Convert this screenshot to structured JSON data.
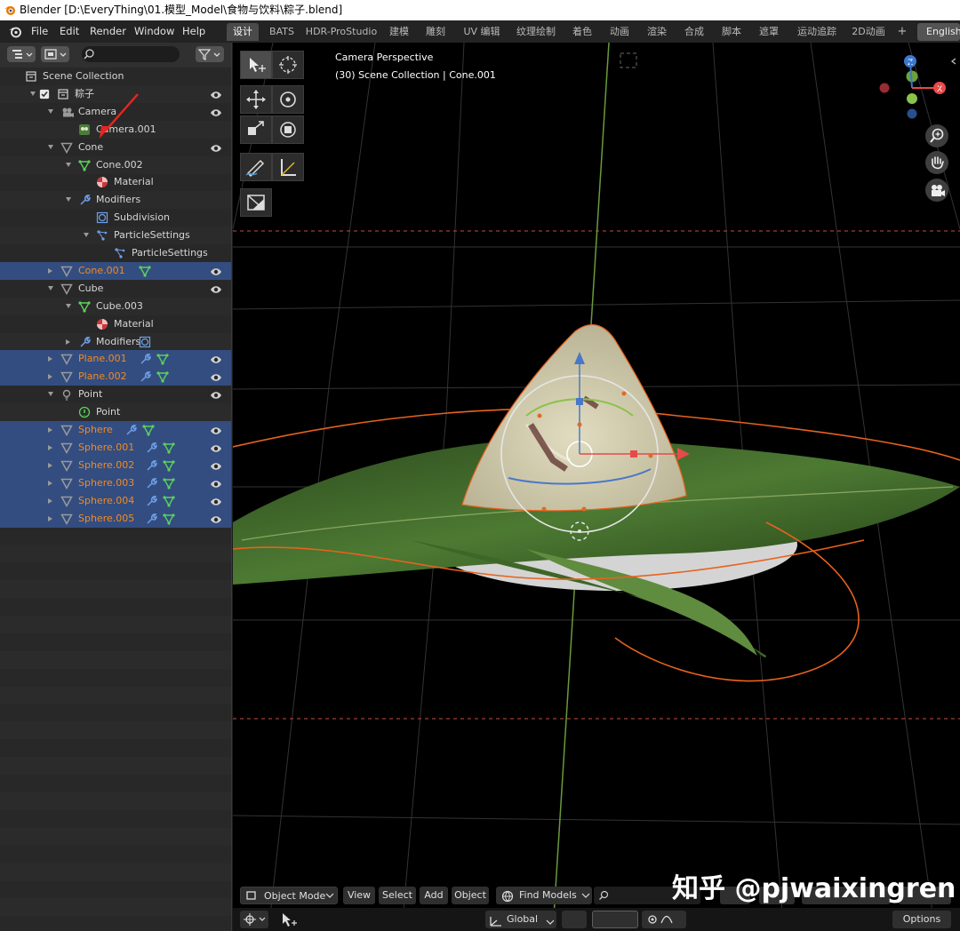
{
  "titlebar": {
    "title": "Blender [D:\\EveryThing\\01.模型_Model\\食物与饮料\\粽子.blend]"
  },
  "menu": [
    "File",
    "Edit",
    "Render",
    "Window",
    "Help"
  ],
  "workspace_tabs": [
    "设计",
    "BATS",
    "HDR-ProStudio",
    "建模",
    "雕刻",
    "UV 编辑",
    "纹理绘制",
    "着色",
    "动画",
    "渲染",
    "合成",
    "脚本",
    "遮罩",
    "运动追踪",
    "2D动画"
  ],
  "workspace_add": "+",
  "language_button": "English",
  "outliner": {
    "rows": [
      {
        "label": "Scene Collection",
        "indent": 0,
        "icon": "collection",
        "arrow": "none",
        "eye": false,
        "selected": false,
        "orange": false
      },
      {
        "label": "粽子",
        "indent": 1,
        "icon": "collection",
        "arrow": "down",
        "eye": true,
        "selected": false,
        "orange": false,
        "checkbox": true
      },
      {
        "label": "Camera",
        "indent": 2,
        "icon": "camera",
        "arrow": "down",
        "eye": true,
        "selected": false,
        "orange": false
      },
      {
        "label": "Camera.001",
        "indent": 3,
        "icon": "camera-data",
        "arrow": "none",
        "eye": false,
        "selected": false,
        "orange": false
      },
      {
        "label": "Cone",
        "indent": 2,
        "icon": "mesh",
        "arrow": "down",
        "eye": true,
        "selected": false,
        "orange": false
      },
      {
        "label": "Cone.002",
        "indent": 3,
        "icon": "mesh-data",
        "arrow": "down",
        "eye": false,
        "selected": false,
        "orange": false
      },
      {
        "label": "Material",
        "indent": 4,
        "icon": "material",
        "arrow": "none",
        "eye": false,
        "selected": false,
        "orange": false
      },
      {
        "label": "Modifiers",
        "indent": 3,
        "icon": "wrench",
        "arrow": "down",
        "eye": false,
        "selected": false,
        "orange": false
      },
      {
        "label": "Subdivision",
        "indent": 4,
        "icon": "subdiv",
        "arrow": "none",
        "eye": false,
        "selected": false,
        "orange": false
      },
      {
        "label": "ParticleSettings",
        "indent": 4,
        "icon": "particle",
        "arrow": "down",
        "eye": false,
        "selected": false,
        "orange": false
      },
      {
        "label": "ParticleSettings",
        "indent": 5,
        "icon": "particle",
        "arrow": "none",
        "eye": false,
        "selected": false,
        "orange": false
      },
      {
        "label": "Cone.001",
        "indent": 2,
        "icon": "mesh",
        "arrow": "right",
        "eye": true,
        "selected": true,
        "orange": true,
        "extras": [
          "mesh-data"
        ]
      },
      {
        "label": "Cube",
        "indent": 2,
        "icon": "mesh",
        "arrow": "down",
        "eye": true,
        "selected": false,
        "orange": false
      },
      {
        "label": "Cube.003",
        "indent": 3,
        "icon": "mesh-data",
        "arrow": "down",
        "eye": false,
        "selected": false,
        "orange": false
      },
      {
        "label": "Material",
        "indent": 4,
        "icon": "material",
        "arrow": "none",
        "eye": false,
        "selected": false,
        "orange": false
      },
      {
        "label": "Modifiers",
        "indent": 3,
        "icon": "wrench",
        "arrow": "right",
        "eye": false,
        "selected": false,
        "orange": false,
        "extras": [
          "subdiv"
        ]
      },
      {
        "label": "Plane.001",
        "indent": 2,
        "icon": "mesh",
        "arrow": "right",
        "eye": true,
        "selected": true,
        "orange": true,
        "extras": [
          "wrench",
          "mesh-data"
        ]
      },
      {
        "label": "Plane.002",
        "indent": 2,
        "icon": "mesh",
        "arrow": "right",
        "eye": true,
        "selected": true,
        "orange": true,
        "extras": [
          "wrench",
          "mesh-data"
        ]
      },
      {
        "label": "Point",
        "indent": 2,
        "icon": "light",
        "arrow": "down",
        "eye": true,
        "selected": false,
        "orange": false
      },
      {
        "label": "Point",
        "indent": 3,
        "icon": "light-data",
        "arrow": "none",
        "eye": false,
        "selected": false,
        "orange": false
      },
      {
        "label": "Sphere",
        "indent": 2,
        "icon": "mesh",
        "arrow": "right",
        "eye": true,
        "selected": true,
        "orange": true,
        "extras": [
          "wrench",
          "mesh-data"
        ]
      },
      {
        "label": "Sphere.001",
        "indent": 2,
        "icon": "mesh",
        "arrow": "right",
        "eye": true,
        "selected": true,
        "orange": true,
        "extras": [
          "wrench",
          "mesh-data"
        ]
      },
      {
        "label": "Sphere.002",
        "indent": 2,
        "icon": "mesh",
        "arrow": "right",
        "eye": true,
        "selected": true,
        "orange": true,
        "extras": [
          "wrench",
          "mesh-data"
        ]
      },
      {
        "label": "Sphere.003",
        "indent": 2,
        "icon": "mesh",
        "arrow": "right",
        "eye": true,
        "selected": true,
        "orange": true,
        "extras": [
          "wrench",
          "mesh-data"
        ]
      },
      {
        "label": "Sphere.004",
        "indent": 2,
        "icon": "mesh",
        "arrow": "right",
        "eye": true,
        "selected": true,
        "orange": true,
        "extras": [
          "wrench",
          "mesh-data"
        ]
      },
      {
        "label": "Sphere.005",
        "indent": 2,
        "icon": "mesh",
        "arrow": "right",
        "eye": true,
        "selected": true,
        "orange": true,
        "extras": [
          "wrench",
          "mesh-data"
        ]
      }
    ]
  },
  "viewport": {
    "view_name": "Camera Perspective",
    "view_context": "(30) Scene Collection | Cone.001",
    "header": {
      "mode": "Object Mode",
      "menus": [
        "View",
        "Select",
        "Add",
        "Object"
      ],
      "find_models": "Find Models"
    },
    "footer": {
      "orientation": "Global",
      "options": "Options"
    }
  },
  "watermark": "知乎 @pjwaixingren",
  "colors": {
    "selection": "#334d80",
    "highlight_text": "#f08a24",
    "object_outline": "#e8621e"
  }
}
